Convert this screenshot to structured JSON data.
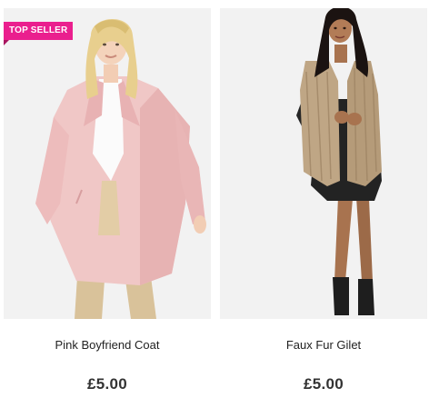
{
  "products": [
    {
      "badge": "TOP SELLER",
      "name": "Pink Boyfriend Coat",
      "price": "£5.00",
      "image": "woman-in-pink-coat-photo",
      "badge_color": "#ea1f8e"
    },
    {
      "name": "Faux Fur Gilet",
      "price": "£5.00",
      "image": "woman-in-faux-fur-gilet-photo"
    }
  ]
}
